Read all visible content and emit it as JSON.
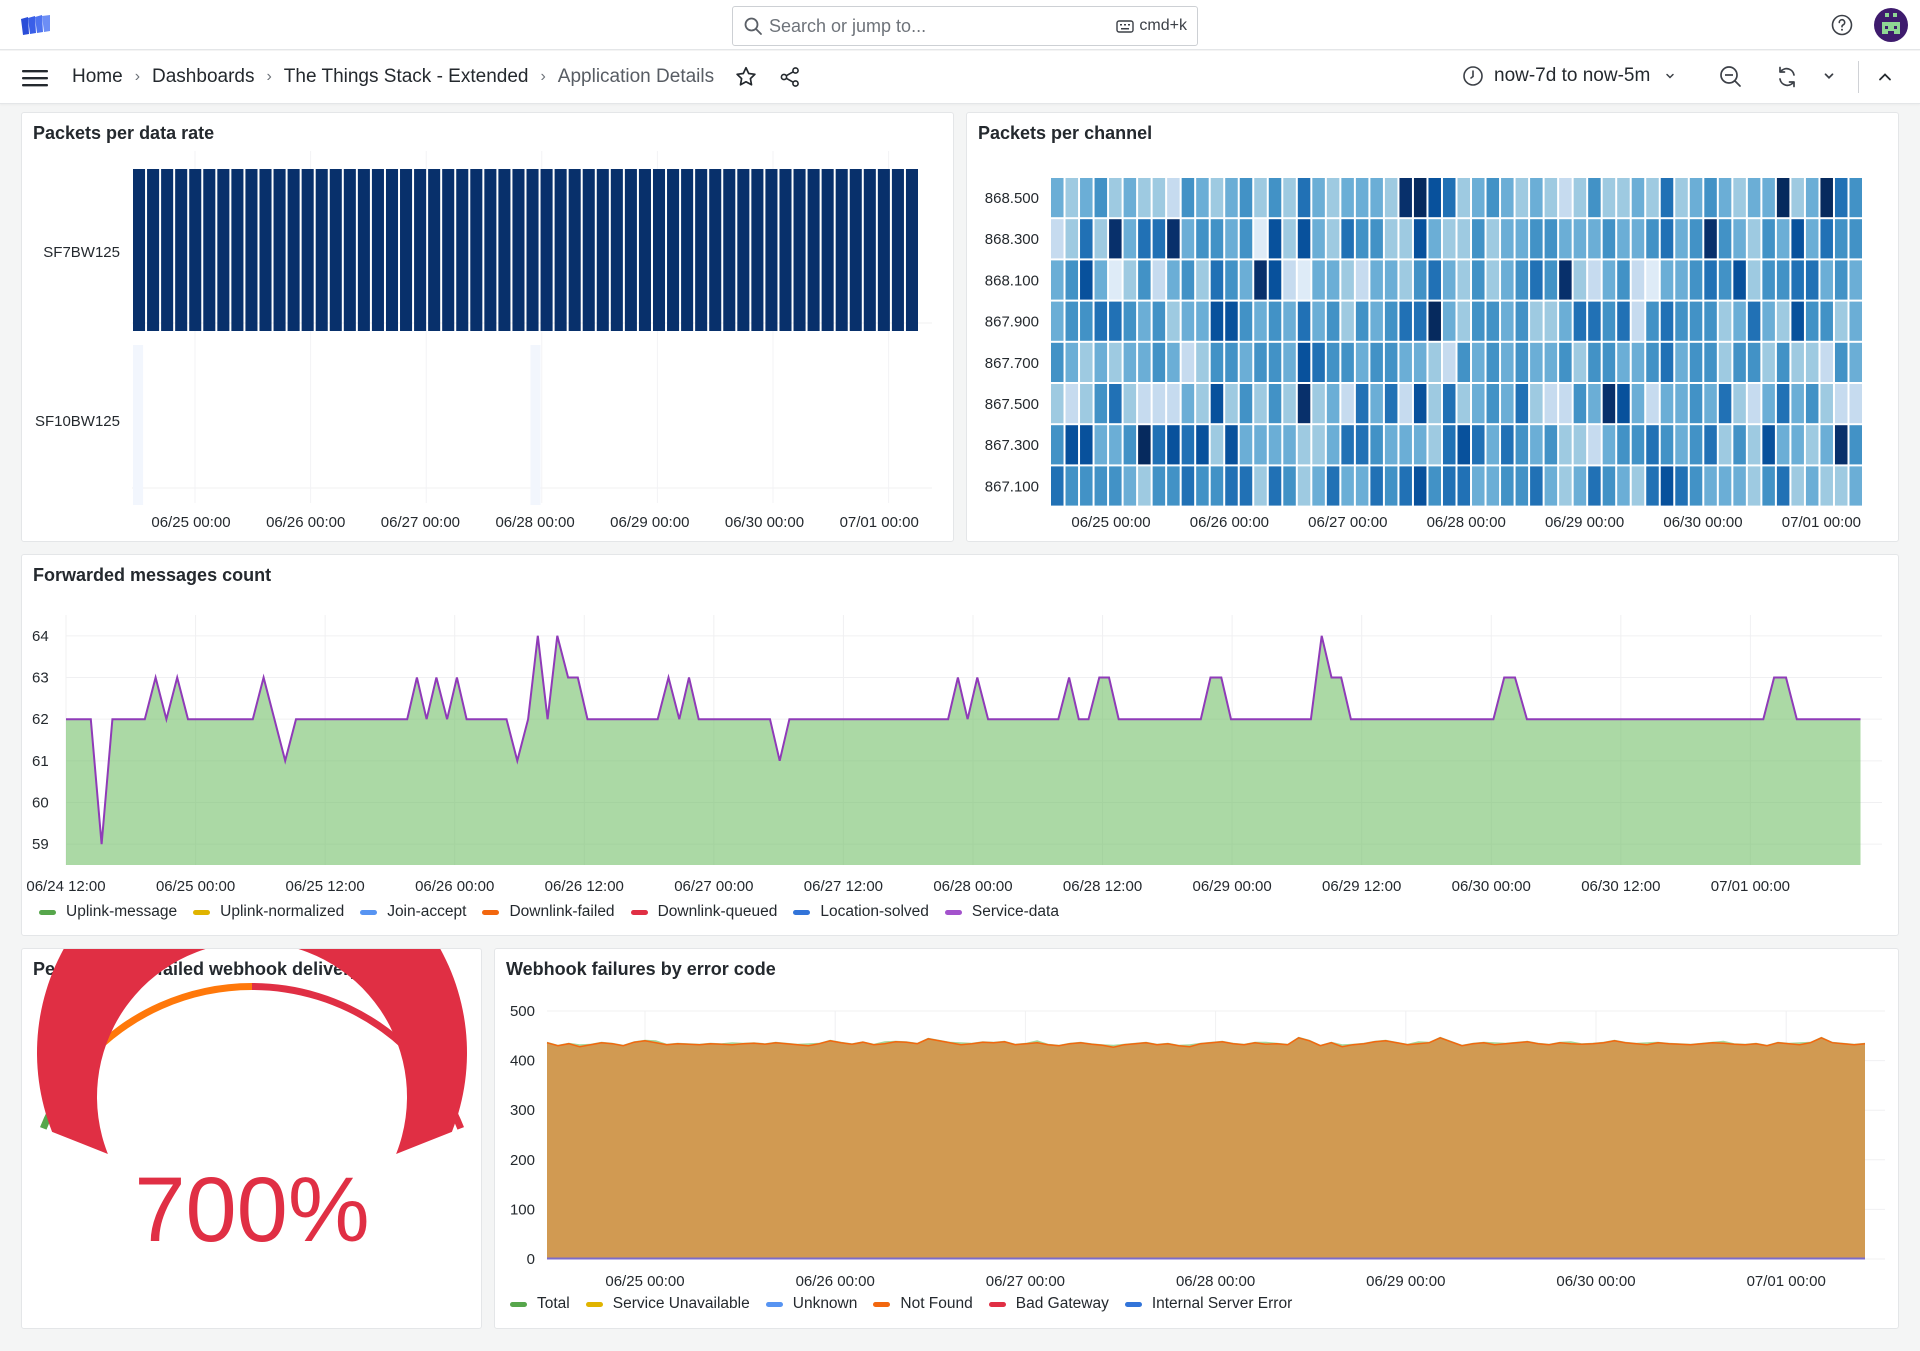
{
  "topbar": {
    "logo_icon": "grafana-logo-icon",
    "search": {
      "placeholder": "Search or jump to...",
      "shortcut": "cmd+k"
    },
    "help_icon": "help-circle-icon",
    "avatar_icon": "user-avatar"
  },
  "navbar": {
    "menu_icon": "hamburger-menu-icon",
    "breadcrumbs": [
      "Home",
      "Dashboards",
      "The Things Stack - Extended",
      "Application Details"
    ],
    "separator": "›",
    "time_range": "now-7d to now-5m",
    "icons": [
      "star-icon",
      "share-icon",
      "clock-icon",
      "zoom-out-icon",
      "refresh-icon",
      "chevron-down-icon",
      "chevron-up-icon"
    ]
  },
  "panels": {
    "data_rate": {
      "title": "Packets per data rate"
    },
    "channel": {
      "title": "Packets per channel"
    },
    "forwarded": {
      "title": "Forwarded messages count"
    },
    "gauge": {
      "title": "Percentage of failed webhook delivery ..."
    },
    "webhook": {
      "title": "Webhook failures by error code"
    }
  },
  "chart_data": [
    {
      "id": "data_rate",
      "type": "heatmap",
      "title": "Packets per data rate",
      "y_categories": [
        "SF7BW125",
        "SF10BW125"
      ],
      "x_tick_labels": [
        "06/25 00:00",
        "06/26 00:00",
        "06/27 00:00",
        "06/28 00:00",
        "06/29 00:00",
        "06/30 00:00",
        "07/01 00:00"
      ],
      "x_range_hours": [
        0,
        168
      ],
      "bucket_hours": 3,
      "buckets": 56,
      "rows": [
        {
          "name": "SF7BW125",
          "intensity": 1.0
        },
        {
          "name": "SF10BW125",
          "intensity": 0.02,
          "sparse_buckets": [
            0,
            28
          ]
        }
      ],
      "color_high": "#08306b",
      "color_low": "#f7fbff"
    },
    {
      "id": "channel",
      "type": "heatmap",
      "title": "Packets per channel",
      "y_categories": [
        "868.500",
        "868.300",
        "868.100",
        "867.900",
        "867.700",
        "867.500",
        "867.300",
        "867.100"
      ],
      "x_tick_labels": [
        "06/25 00:00",
        "06/26 00:00",
        "06/27 00:00",
        "06/28 00:00",
        "06/29 00:00",
        "06/30 00:00",
        "07/01 00:00"
      ],
      "buckets": 56,
      "intensity_scale": "0-9 (0 = lightest, 9 = darkest)",
      "rows": [
        "4345343325434535364344438976345434323533436345434493496539",
        "2363846684554517374365533743353445544454456458543547465554",
        "4574135245365487214432443564353456583245214456573556645445",
        "4556654534477545464535456694355453346656256555346437553444",
        "5434344542355455476554554432545454453554456455355353325464",
        "3235632224373535383426462736345463225487424454632464532243",
        "5774459676737444433466544436764654533245565456353744348538",
        "6555543556556636534644656756644556434654367654443563433456"
      ],
      "palette": [
        "#f7fbff",
        "#deebf7",
        "#c6dbef",
        "#9ecae1",
        "#6baed6",
        "#4292c6",
        "#2171b5",
        "#08519c",
        "#08306b",
        "#062a5e"
      ]
    },
    {
      "id": "forwarded",
      "type": "area",
      "title": "Forwarded messages count",
      "ylim": [
        58.5,
        64.5
      ],
      "y_ticks": [
        59,
        60,
        61,
        62,
        63,
        64
      ],
      "x_tick_labels": [
        "06/24 12:00",
        "06/25 00:00",
        "06/25 12:00",
        "06/26 00:00",
        "06/26 12:00",
        "06/27 00:00",
        "06/27 12:00",
        "06/28 00:00",
        "06/28 12:00",
        "06/29 00:00",
        "06/29 12:00",
        "06/30 00:00",
        "06/30 12:00",
        "07/01 00:00"
      ],
      "x_unit": "hours since 06/24 12:00",
      "x_range": [
        0,
        168
      ],
      "series": [
        {
          "name": "Service-data",
          "color": "#8f3bb8",
          "fill": "#73bf69",
          "points": [
            [
              0,
              62
            ],
            [
              2.3,
              62
            ],
            [
              3.3,
              59
            ],
            [
              4.3,
              62
            ],
            [
              7.3,
              62
            ],
            [
              8.3,
              63
            ],
            [
              9.3,
              62
            ],
            [
              10.3,
              63
            ],
            [
              11.3,
              62
            ],
            [
              17.3,
              62
            ],
            [
              18.3,
              63
            ],
            [
              20.3,
              61
            ],
            [
              21.3,
              62
            ],
            [
              31.6,
              62
            ],
            [
              32.5,
              63
            ],
            [
              33.4,
              62
            ],
            [
              34.3,
              63
            ],
            [
              35.3,
              62
            ],
            [
              36.2,
              63
            ],
            [
              37.1,
              62
            ],
            [
              40.8,
              62
            ],
            [
              41.8,
              61
            ],
            [
              42.8,
              62
            ],
            [
              43.7,
              64
            ],
            [
              44.6,
              62
            ],
            [
              45.5,
              64
            ],
            [
              46.5,
              63
            ],
            [
              47.4,
              63
            ],
            [
              48.3,
              62
            ],
            [
              54.8,
              62
            ],
            [
              55.8,
              63
            ],
            [
              56.8,
              62
            ],
            [
              57.7,
              63
            ],
            [
              58.6,
              62
            ],
            [
              65.2,
              62
            ],
            [
              66.1,
              61
            ],
            [
              67.0,
              62
            ],
            [
              81.7,
              62
            ],
            [
              82.6,
              63
            ],
            [
              83.5,
              62
            ],
            [
              84.4,
              63
            ],
            [
              85.4,
              62
            ],
            [
              91.9,
              62
            ],
            [
              92.9,
              63
            ],
            [
              93.8,
              62
            ],
            [
              94.7,
              62
            ],
            [
              95.7,
              63
            ],
            [
              96.6,
              63
            ],
            [
              97.5,
              62
            ],
            [
              105.1,
              62
            ],
            [
              106.0,
              63
            ],
            [
              107.0,
              63
            ],
            [
              107.9,
              62
            ],
            [
              115.3,
              62
            ],
            [
              116.3,
              64
            ],
            [
              117.2,
              63
            ],
            [
              118.1,
              63
            ],
            [
              119.0,
              62
            ],
            [
              132.2,
              62
            ],
            [
              133.2,
              63
            ],
            [
              134.2,
              63
            ],
            [
              135.3,
              62
            ],
            [
              157.2,
              62
            ],
            [
              158.2,
              63
            ],
            [
              159.3,
              63
            ],
            [
              160.3,
              62
            ],
            [
              166.2,
              62
            ]
          ]
        }
      ],
      "legend": [
        {
          "name": "Uplink-message",
          "color": "#56a64b"
        },
        {
          "name": "Uplink-normalized",
          "color": "#e0b400"
        },
        {
          "name": "Join-accept",
          "color": "#5794f2"
        },
        {
          "name": "Downlink-failed",
          "color": "#f2670f"
        },
        {
          "name": "Downlink-queued",
          "color": "#e02f44"
        },
        {
          "name": "Location-solved",
          "color": "#3274d9"
        },
        {
          "name": "Service-data",
          "color": "#a352cc"
        }
      ],
      "legend_placement": "bottom"
    },
    {
      "id": "gauge",
      "type": "gauge",
      "title": "Percentage of failed webhook delivery ...",
      "value": 700,
      "unit": "%",
      "display": "700%",
      "thresholds": [
        {
          "from": 0,
          "color": "#56a64b"
        },
        {
          "from": 0.1,
          "color": "#ff780a"
        },
        {
          "from": 0.5,
          "color": "#e02f44"
        }
      ],
      "threshold_fractions_of_arc": [
        0.15,
        0.5,
        1.0
      ],
      "value_color": "#e02f44"
    },
    {
      "id": "webhook",
      "type": "area",
      "title": "Webhook failures by error code",
      "ylim": [
        0,
        500
      ],
      "y_ticks": [
        0,
        100,
        200,
        300,
        400,
        500
      ],
      "x_tick_labels": [
        "06/25 00:00",
        "06/26 00:00",
        "06/27 00:00",
        "06/28 00:00",
        "06/29 00:00",
        "06/30 00:00",
        "07/01 00:00"
      ],
      "series": [
        {
          "name": "Not Found",
          "color": "#f2670f",
          "fill": "#d19a52",
          "values": [
            436,
            430,
            434,
            428,
            432,
            436,
            434,
            430,
            437,
            440,
            436,
            432,
            434,
            433,
            432,
            434,
            433,
            432,
            434,
            435,
            433,
            436,
            434,
            432,
            430,
            434,
            440,
            436,
            433,
            437,
            432,
            434,
            438,
            437,
            434,
            444,
            440,
            436,
            432,
            434,
            437,
            436,
            438,
            432,
            434,
            436,
            432,
            430,
            434,
            436,
            433,
            431,
            427,
            432,
            434,
            436,
            432,
            434,
            430,
            428,
            434,
            436,
            438,
            434,
            432,
            436,
            433,
            434,
            432,
            446,
            440,
            430,
            436,
            428,
            432,
            434,
            438,
            440,
            436,
            432,
            434,
            436,
            446,
            438,
            430,
            434,
            436,
            432,
            434,
            436,
            438,
            434,
            432,
            436,
            434,
            433,
            434,
            436,
            440,
            436,
            434,
            432,
            436,
            434,
            433,
            432,
            434,
            436,
            435,
            433,
            432,
            434,
            430,
            436,
            434,
            432,
            436,
            446,
            436,
            434,
            432,
            434
          ]
        },
        {
          "name": "Total",
          "color": "#56a64b",
          "fill": "#8ecb80",
          "offset_above_not_found": 2
        },
        {
          "name": "Service Unavailable",
          "color": "#e0b400",
          "values_const": 0
        },
        {
          "name": "Unknown",
          "color": "#5794f2",
          "values_const": 1
        },
        {
          "name": "Bad Gateway",
          "color": "#e02f44",
          "values_const": 0
        },
        {
          "name": "Internal Server Error",
          "color": "#3274d9",
          "values_const": 2
        }
      ],
      "legend": [
        {
          "name": "Total",
          "color": "#56a64b"
        },
        {
          "name": "Service Unavailable",
          "color": "#e0b400"
        },
        {
          "name": "Unknown",
          "color": "#5794f2"
        },
        {
          "name": "Not Found",
          "color": "#f2670f"
        },
        {
          "name": "Bad Gateway",
          "color": "#e02f44"
        },
        {
          "name": "Internal Server Error",
          "color": "#3274d9"
        }
      ],
      "legend_placement": "bottom"
    }
  ]
}
